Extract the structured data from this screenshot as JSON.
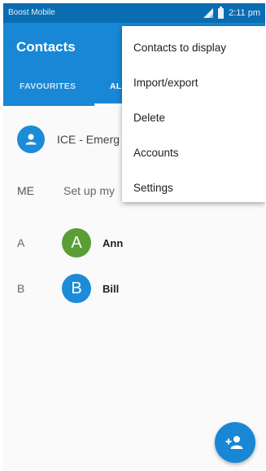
{
  "status_bar": {
    "carrier": "Boost Mobile",
    "time": "2:11 pm",
    "icons": [
      "signal-icon",
      "battery-icon"
    ]
  },
  "app_bar": {
    "title": "Contacts",
    "tabs": [
      {
        "label": "FAVOURITES",
        "selected": false
      },
      {
        "label": "AL",
        "selected": true
      }
    ]
  },
  "list": {
    "ice_label": "ICE - Emerg",
    "me_letter": "ME",
    "me_text": "Set up my",
    "contacts": [
      {
        "section": "A",
        "initial": "A",
        "name": "Ann",
        "color": "#5a9e35"
      },
      {
        "section": "B",
        "initial": "B",
        "name": "Bill",
        "color": "#1c8bd8"
      }
    ]
  },
  "overflow_menu": {
    "items": [
      {
        "label": "Contacts to display"
      },
      {
        "label": "Import/export"
      },
      {
        "label": "Delete"
      },
      {
        "label": "Accounts"
      },
      {
        "label": "Settings"
      }
    ]
  },
  "fab": {
    "icon": "add-contact-icon"
  },
  "colors": {
    "status_bar": "#0a6db1",
    "app_bar": "#1887d6",
    "accent": "#1887d6"
  }
}
